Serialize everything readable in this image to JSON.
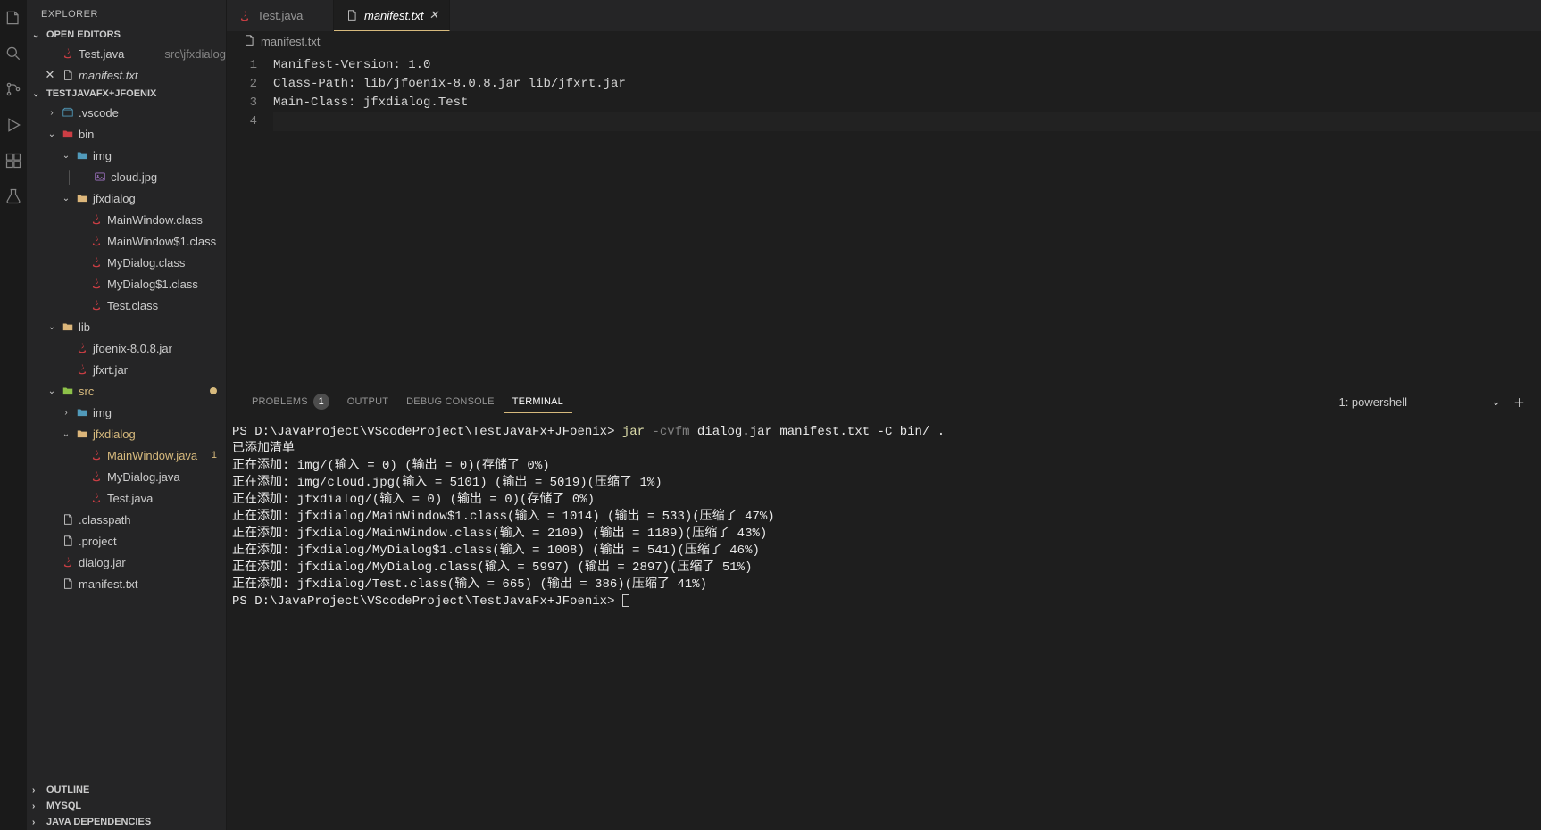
{
  "sidebar": {
    "title": "EXPLORER",
    "openEditors": {
      "label": "OPEN EDITORS",
      "items": [
        {
          "name": "Test.java",
          "path": "src\\jfxdialog",
          "icon": "java",
          "close": false
        },
        {
          "name": "manifest.txt",
          "path": "",
          "icon": "txt",
          "close": true,
          "italic": true
        }
      ]
    },
    "project": {
      "label": "TESTJAVAFX+JFOENIX"
    },
    "tree": [
      {
        "indent": 1,
        "chev": ">",
        "icon": "set",
        "name": ".vscode"
      },
      {
        "indent": 1,
        "chev": "v",
        "icon": "folder-r",
        "name": "bin"
      },
      {
        "indent": 2,
        "chev": "v",
        "icon": "folder-b",
        "name": "img"
      },
      {
        "indent": 3,
        "chev": "",
        "icon": "img",
        "name": "cloud.jpg",
        "pipe": true
      },
      {
        "indent": 2,
        "chev": "v",
        "icon": "folder-y",
        "name": "jfxdialog"
      },
      {
        "indent": 3,
        "chev": "",
        "icon": "java",
        "name": "MainWindow.class"
      },
      {
        "indent": 3,
        "chev": "",
        "icon": "java",
        "name": "MainWindow$1.class"
      },
      {
        "indent": 3,
        "chev": "",
        "icon": "java",
        "name": "MyDialog.class"
      },
      {
        "indent": 3,
        "chev": "",
        "icon": "java",
        "name": "MyDialog$1.class"
      },
      {
        "indent": 3,
        "chev": "",
        "icon": "java",
        "name": "Test.class"
      },
      {
        "indent": 1,
        "chev": "v",
        "icon": "folder-y",
        "name": "lib"
      },
      {
        "indent": 2,
        "chev": "",
        "icon": "java",
        "name": "jfoenix-8.0.8.jar"
      },
      {
        "indent": 2,
        "chev": "",
        "icon": "java",
        "name": "jfxrt.jar"
      },
      {
        "indent": 1,
        "chev": "v",
        "icon": "folder-g",
        "name": "src",
        "modified": true,
        "dot": true
      },
      {
        "indent": 2,
        "chev": ">",
        "icon": "folder-b",
        "name": "img"
      },
      {
        "indent": 2,
        "chev": "v",
        "icon": "folder-y",
        "name": "jfxdialog",
        "modified": true
      },
      {
        "indent": 3,
        "chev": "",
        "icon": "java",
        "name": "MainWindow.java",
        "modified": true,
        "badge": "1"
      },
      {
        "indent": 3,
        "chev": "",
        "icon": "java",
        "name": "MyDialog.java"
      },
      {
        "indent": 3,
        "chev": "",
        "icon": "java",
        "name": "Test.java"
      },
      {
        "indent": 1,
        "chev": "",
        "icon": "file",
        "name": ".classpath"
      },
      {
        "indent": 1,
        "chev": "",
        "icon": "file",
        "name": ".project"
      },
      {
        "indent": 1,
        "chev": "",
        "icon": "java",
        "name": "dialog.jar"
      },
      {
        "indent": 1,
        "chev": "",
        "icon": "txt",
        "name": "manifest.txt"
      }
    ],
    "bottomSections": [
      {
        "label": "OUTLINE"
      },
      {
        "label": "MYSQL"
      },
      {
        "label": "JAVA DEPENDENCIES"
      }
    ]
  },
  "tabs": [
    {
      "name": "Test.java",
      "icon": "java",
      "active": false
    },
    {
      "name": "manifest.txt",
      "icon": "txt",
      "active": true,
      "italic": true,
      "close": true
    }
  ],
  "breadcrumb": {
    "icon": "txt",
    "name": "manifest.txt"
  },
  "editor": {
    "lines": [
      "Manifest-Version: 1.0",
      "Class-Path: lib/jfoenix-8.0.8.jar lib/jfxrt.jar",
      "Main-Class: jfxdialog.Test",
      ""
    ]
  },
  "panel": {
    "tabs": [
      {
        "label": "PROBLEMS",
        "badge": "1"
      },
      {
        "label": "OUTPUT"
      },
      {
        "label": "DEBUG CONSOLE"
      },
      {
        "label": "TERMINAL",
        "active": true
      }
    ],
    "terminalSelector": "1: powershell"
  },
  "terminal": {
    "prompt1_prefix": "PS D:\\JavaProject\\VScodeProject\\TestJavaFx+JFoenix> ",
    "cmd_bin": "jar",
    "cmd_flag": " -cvfm ",
    "cmd_rest": "dialog.jar manifest.txt -C bin/ .",
    "lines": [
      "已添加清单",
      "正在添加: img/(输入 = 0) (输出 = 0)(存储了 0%)",
      "正在添加: img/cloud.jpg(输入 = 5101) (输出 = 5019)(压缩了 1%)",
      "正在添加: jfxdialog/(输入 = 0) (输出 = 0)(存储了 0%)",
      "正在添加: jfxdialog/MainWindow$1.class(输入 = 1014) (输出 = 533)(压缩了 47%)",
      "正在添加: jfxdialog/MainWindow.class(输入 = 2109) (输出 = 1189)(压缩了 43%)",
      "正在添加: jfxdialog/MyDialog$1.class(输入 = 1008) (输出 = 541)(压缩了 46%)",
      "正在添加: jfxdialog/MyDialog.class(输入 = 5997) (输出 = 2897)(压缩了 51%)",
      "正在添加: jfxdialog/Test.class(输入 = 665) (输出 = 386)(压缩了 41%)"
    ],
    "prompt2": "PS D:\\JavaProject\\VScodeProject\\TestJavaFx+JFoenix> "
  }
}
